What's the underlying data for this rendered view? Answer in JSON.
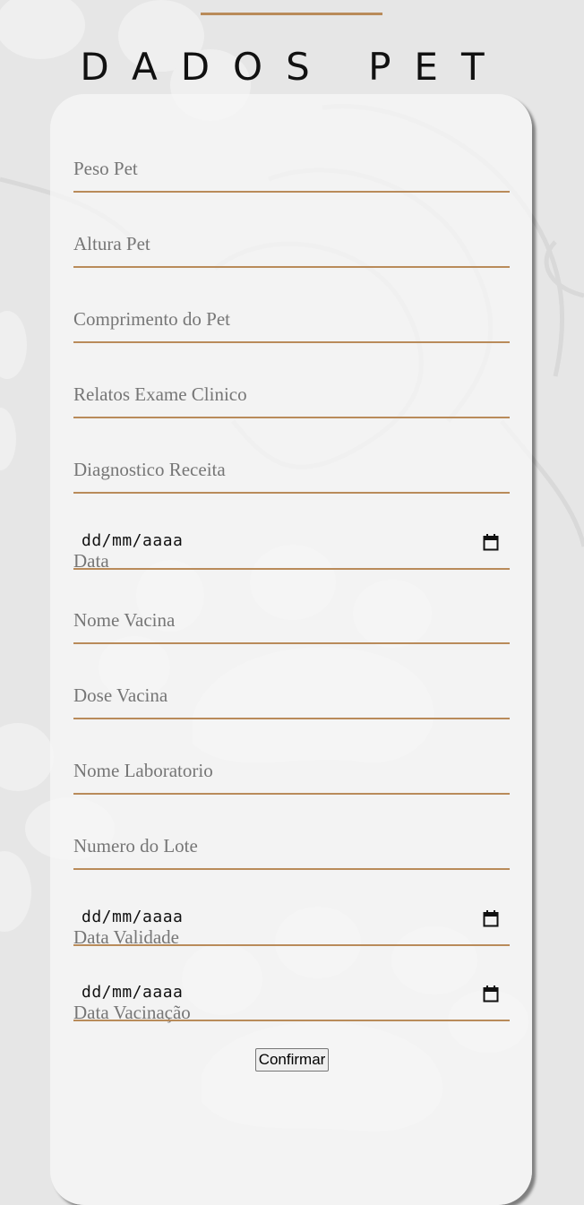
{
  "title": "DADOS PET",
  "fields": [
    {
      "type": "text",
      "placeholder": "Peso Pet"
    },
    {
      "type": "text",
      "placeholder": "Altura Pet"
    },
    {
      "type": "text",
      "placeholder": "Comprimento do Pet"
    },
    {
      "type": "text",
      "placeholder": "Relatos Exame Clinico"
    },
    {
      "type": "text",
      "placeholder": "Diagnostico Receita"
    },
    {
      "type": "date",
      "label": "Data",
      "value": "dd/mm/aaaa",
      "icon": "calendar-icon"
    },
    {
      "type": "text",
      "placeholder": "Nome Vacina"
    },
    {
      "type": "text",
      "placeholder": "Dose Vacina"
    },
    {
      "type": "text",
      "placeholder": "Nome Laboratorio"
    },
    {
      "type": "text",
      "placeholder": "Numero do Lote"
    },
    {
      "type": "date",
      "label": "Data Validade",
      "value": "dd/mm/aaaa",
      "icon": "calendar-icon"
    },
    {
      "type": "date",
      "label": "Data Vacinação",
      "value": "dd/mm/aaaa",
      "icon": "calendar-icon"
    }
  ],
  "submit_label": "Confirmar",
  "colors": {
    "accent": "#b98b5a",
    "background": "#e6e6e6",
    "card": "#f4f4f4",
    "placeholder": "#767676"
  }
}
